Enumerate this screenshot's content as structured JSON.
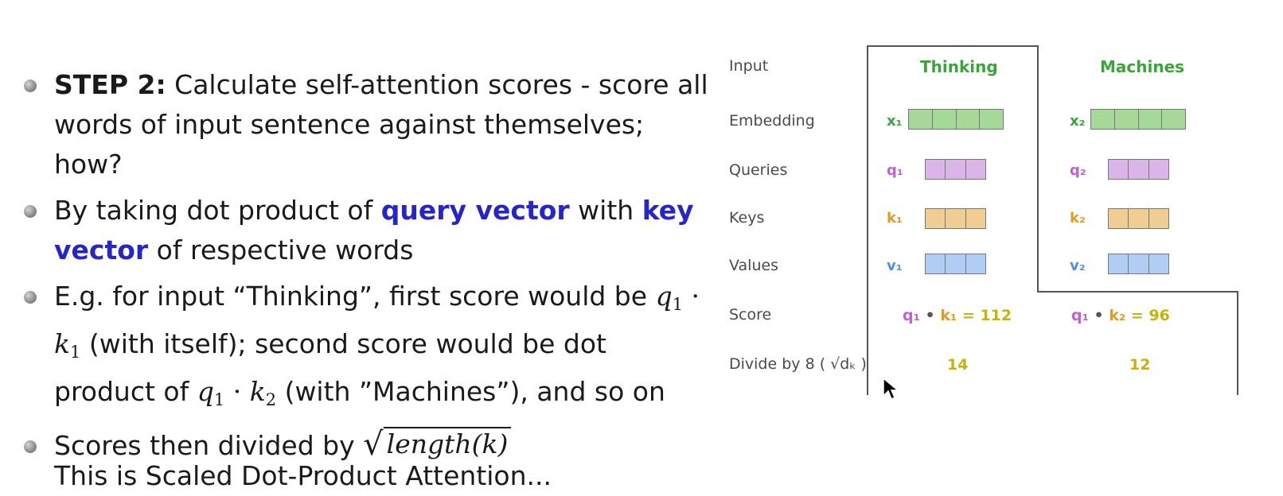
{
  "slide": {
    "bullets": [
      {
        "bold_lead": "STEP 2:",
        "text": " Calculate self-attention scores - score all words of input sentence against themselves; how?"
      },
      {
        "t1": "By taking dot product of ",
        "hl1": "query vector",
        "t2": " with ",
        "hl2": "key vector",
        "t3": " of respective words"
      },
      {
        "t1": "E.g. for input “Thinking”, first score would be ",
        "m1": "q",
        "m1s": "1",
        "dot1": " · ",
        "m2": "k",
        "m2s": "1",
        "t2": " (with itself); second score would be dot product of ",
        "m3": "q",
        "m3s": "1",
        "dot2": " · ",
        "m4": "k",
        "m4s": "2",
        "t3": " (with ”Machines”), and so on"
      },
      {
        "t1": "Scores then divided by ",
        "sqrt_symbol": "√",
        "sqrt_body": "length(k)"
      }
    ],
    "cutoff_text": "This is Scaled Dot-Product Attention..."
  },
  "diagram": {
    "rows": [
      "Input",
      "Embedding",
      "Queries",
      "Keys",
      "Values",
      "Score",
      "Divide by 8 ( √dₖ )"
    ],
    "words": [
      "Thinking",
      "Machines"
    ],
    "vectors": {
      "x1": "x₁",
      "x2": "x₂",
      "q1": "q₁",
      "q2": "q₂",
      "k1": "k₁",
      "k2": "k₂",
      "v1": "v₁",
      "v2": "v₂"
    },
    "scores": [
      {
        "q": "q₁",
        "op": " • ",
        "k": "k₁",
        "eq": " = ",
        "value": "112"
      },
      {
        "q": "q₁",
        "op": " • ",
        "k": "k₂",
        "eq": " = ",
        "value": "96"
      }
    ],
    "divided": [
      "14",
      "12"
    ],
    "colors": {
      "embedding": "#a6d89a",
      "query": "#dbb5ea",
      "key": "#f0cd92",
      "value": "#b0cdf3",
      "word": "#3aa63a",
      "score": "#c8b20a"
    }
  }
}
